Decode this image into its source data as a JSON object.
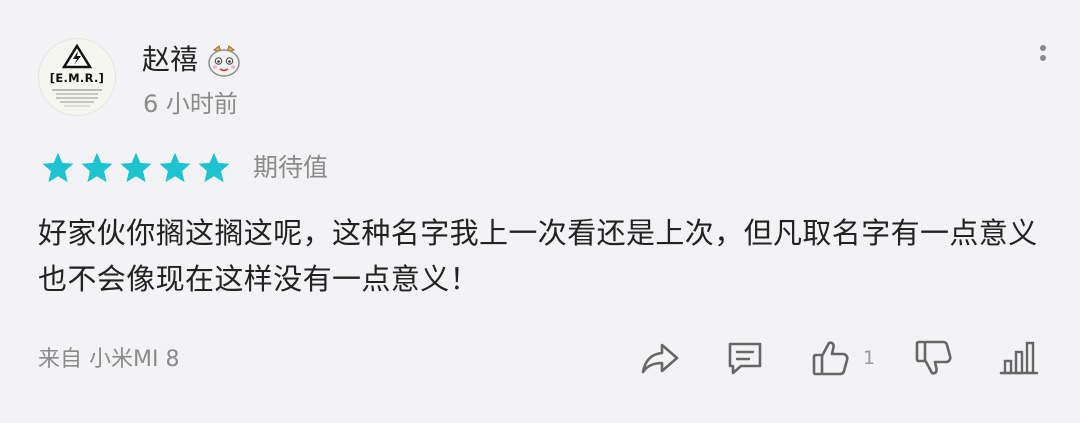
{
  "user": {
    "name": "赵禧",
    "time": "6 小时前",
    "avatar_text": "[E.M.R.]",
    "medal_icon": "medal-icon"
  },
  "rating": {
    "stars": 5,
    "max": 5,
    "label": "期待值",
    "color": "#1ec3d0"
  },
  "content": {
    "text": "好家伙你搁这搁这呢，这种名字我上一次看还是上次，但凡取名字有一点意义也不会像现在这样没有一点意义！"
  },
  "footer": {
    "device": "来自 小米MI 8",
    "like_count": "1",
    "actions": [
      "share-icon",
      "comment-icon",
      "thumbs-up-icon",
      "thumbs-down-icon",
      "stats-icon"
    ]
  },
  "colors": {
    "background": "#f3f3f5",
    "text": "#222222",
    "secondary": "#8a8a8a",
    "icon": "#666666"
  }
}
